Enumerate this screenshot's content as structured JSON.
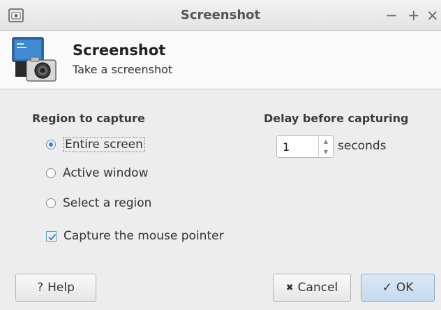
{
  "window": {
    "title": "Screenshot",
    "controls": {
      "minimize": "−",
      "maximize": "+",
      "close": "×"
    }
  },
  "header": {
    "title": "Screenshot",
    "subtitle": "Take a screenshot",
    "icon": "screenshot-camera-icon"
  },
  "region": {
    "heading": "Region to capture",
    "options": [
      {
        "label": "Entire screen",
        "selected": true
      },
      {
        "label": "Active window",
        "selected": false
      },
      {
        "label": "Select a region",
        "selected": false
      }
    ],
    "capture_pointer": {
      "label": "Capture the mouse pointer",
      "checked": true
    }
  },
  "delay": {
    "heading": "Delay before capturing",
    "value": "1",
    "units": "seconds"
  },
  "buttons": {
    "help": {
      "icon": "?",
      "label": "Help"
    },
    "cancel": {
      "icon": "✖",
      "label": "Cancel"
    },
    "ok": {
      "icon": "✓",
      "label": "OK"
    }
  },
  "colors": {
    "accent": "#4a7fb4",
    "ok_button": "#c5d9ee"
  }
}
